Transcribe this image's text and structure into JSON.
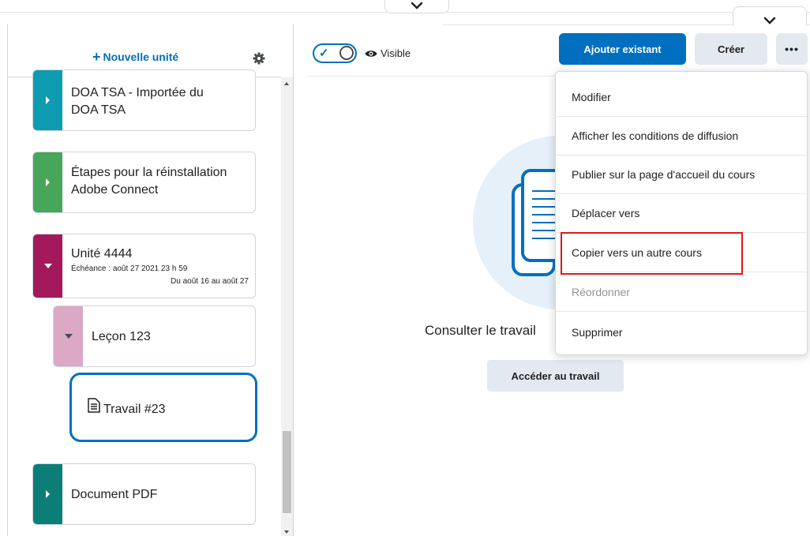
{
  "sidebar": {
    "new_unit_label": "Nouvelle unité",
    "units": [
      {
        "title_line1": "DOA TSA - Importée du",
        "title_line2": "DOA TSA",
        "color": "#0e9bb2"
      },
      {
        "title_line1": "Étapes pour la réinstallation",
        "title_line2": "Adobe Connect",
        "color": "#48a65a"
      },
      {
        "title": "Unité 4444",
        "due": "Échéance : août 27 2021 23 h 59",
        "range": "Du août 16 au août 27",
        "color": "#a3195b"
      },
      {
        "title": "Leçon 123",
        "color": "#dba9c5"
      },
      {
        "title": "Travail #23"
      },
      {
        "title": "Document PDF",
        "color": "#0b7e78"
      }
    ]
  },
  "main": {
    "visibility_label": "Visible",
    "add_existing_label": "Ajouter existant",
    "create_label": "Créer",
    "more_label": "•••",
    "empty_text": "Consulter le travail",
    "access_label": "Accéder au travail"
  },
  "menu": {
    "items": [
      {
        "label": "Modifier"
      },
      {
        "label": "Afficher les conditions de diffusion"
      },
      {
        "label": "Publier sur la page d'accueil du cours"
      },
      {
        "label": "Déplacer vers"
      },
      {
        "label": "Copier vers un autre cours"
      },
      {
        "label": "Réordonner",
        "disabled": true
      },
      {
        "label": "Supprimer"
      }
    ]
  },
  "colors": {
    "accent": "#006fbf",
    "highlight": "#e4151c"
  }
}
